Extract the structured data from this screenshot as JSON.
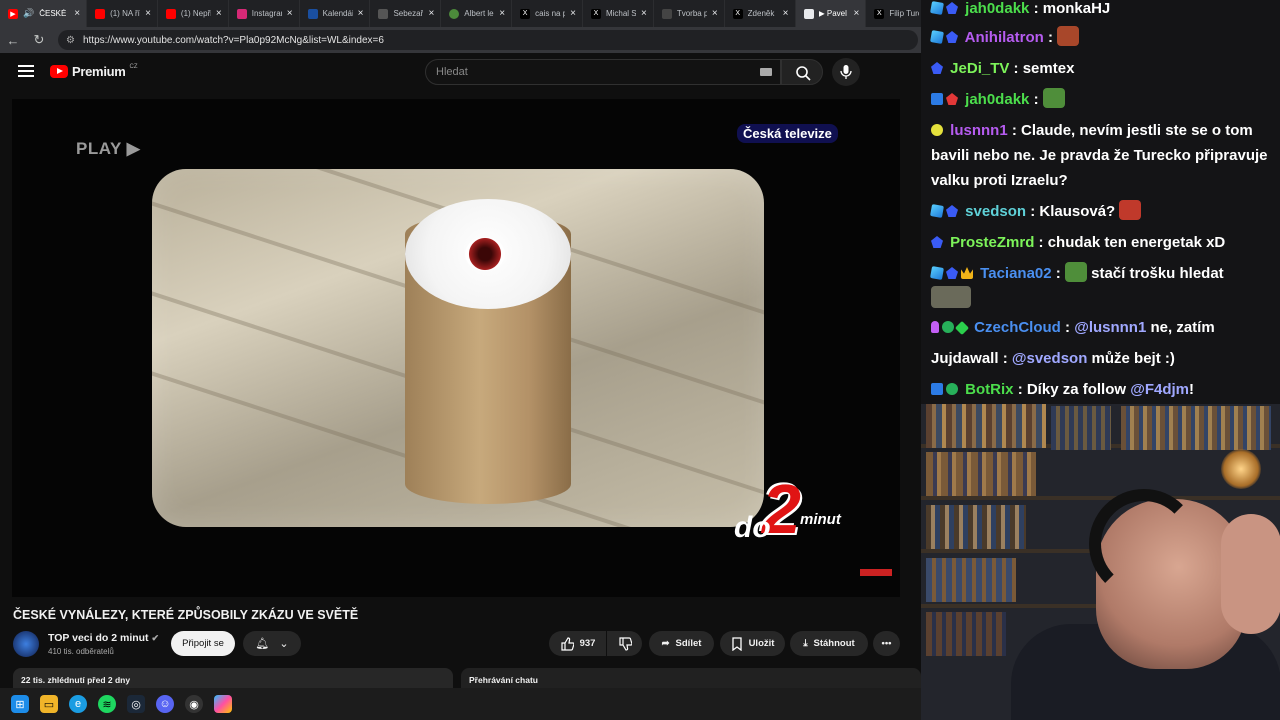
{
  "browser": {
    "tabs": [
      {
        "title": "ČESKÉ",
        "color": "#ff0000",
        "active": true
      },
      {
        "title": "(1) NA ří",
        "color": "#ff0000"
      },
      {
        "title": "(1) Nepři",
        "color": "#ff0000"
      },
      {
        "title": "Instagram",
        "color": "#d62976"
      },
      {
        "title": "Kalendář",
        "color": "#1a4fa0"
      },
      {
        "title": "Sebezař",
        "color": "#555555"
      },
      {
        "title": "Albert le",
        "color": "#4c8a3b"
      },
      {
        "title": "cais na p",
        "color": "#000000"
      },
      {
        "title": "Michal S",
        "color": "#000000"
      },
      {
        "title": "Tvorba p",
        "color": "#444444"
      },
      {
        "title": "Zdeněk",
        "color": "#000000"
      },
      {
        "title": "▶ Pavel u",
        "color": "#e8eaed",
        "active": true
      },
      {
        "title": "Filip Turc",
        "color": "#000000"
      }
    ],
    "url": "https://www.youtube.com/watch?v=Pla0p92McNg&list=WL&index=6"
  },
  "youtube": {
    "logo_text": "Premium",
    "logo_region": "CZ",
    "search_placeholder": "Hledat"
  },
  "video": {
    "overlay_play": "PLAY ▶",
    "channel_logo": "Česká televize",
    "brand_do": "do",
    "brand_2": "2",
    "brand_minut": "minut",
    "title": "ČESKÉ VYNÁLEZY, KTERÉ ZPŮSOBILY ZKÁZU VE SVĚTĚ",
    "channel_name": "TOP veci do 2 minut",
    "subscribers": "410 tis. odběratelů",
    "join_label": "Připojit se",
    "likes": "937",
    "share_label": "Sdílet",
    "save_label": "Uložit",
    "download_label": "Stáhnout",
    "views_date": "22 tis. zhlédnutí  před 2 dny",
    "chat_replay": "Přehrávání chatu"
  },
  "chat": {
    "messages": [
      {
        "user": "jah0dakk",
        "text": ": monkaHJ"
      },
      {
        "user": "Anihilatron",
        "text": ":"
      },
      {
        "user": "JeDi_TV",
        "text": ": semtex"
      },
      {
        "user": "jah0dakk",
        "text": ":"
      },
      {
        "user": "lusnnn1",
        "text": ": Claude, nevím jestli ste se o tom bavili nebo ne. Je pravda že Turecko připravuje valku proti Izraelu?"
      },
      {
        "user": "svedson",
        "text": ": Klausová?"
      },
      {
        "user": "ProsteZmrd",
        "text": ": chudak ten energetak xD"
      },
      {
        "user": "Taciana02",
        "text": ":",
        "text2": "stačí trošku hledat"
      },
      {
        "user": "CzechCloud",
        "text": ":",
        "mention": "@lusnnn1",
        "text2": " ne, zatím"
      },
      {
        "user": "Jujdawall",
        "text": ":",
        "mention": "@svedson",
        "text2": " může bejt :)"
      },
      {
        "user": "BotRix",
        "text": ": Díky za follow",
        "mention": "@F4djm",
        "text2": "!"
      }
    ]
  },
  "taskbar": {
    "icons": [
      "windows-start",
      "file-explorer",
      "edge",
      "spotify",
      "steam",
      "discord",
      "obs",
      "copilot"
    ]
  }
}
